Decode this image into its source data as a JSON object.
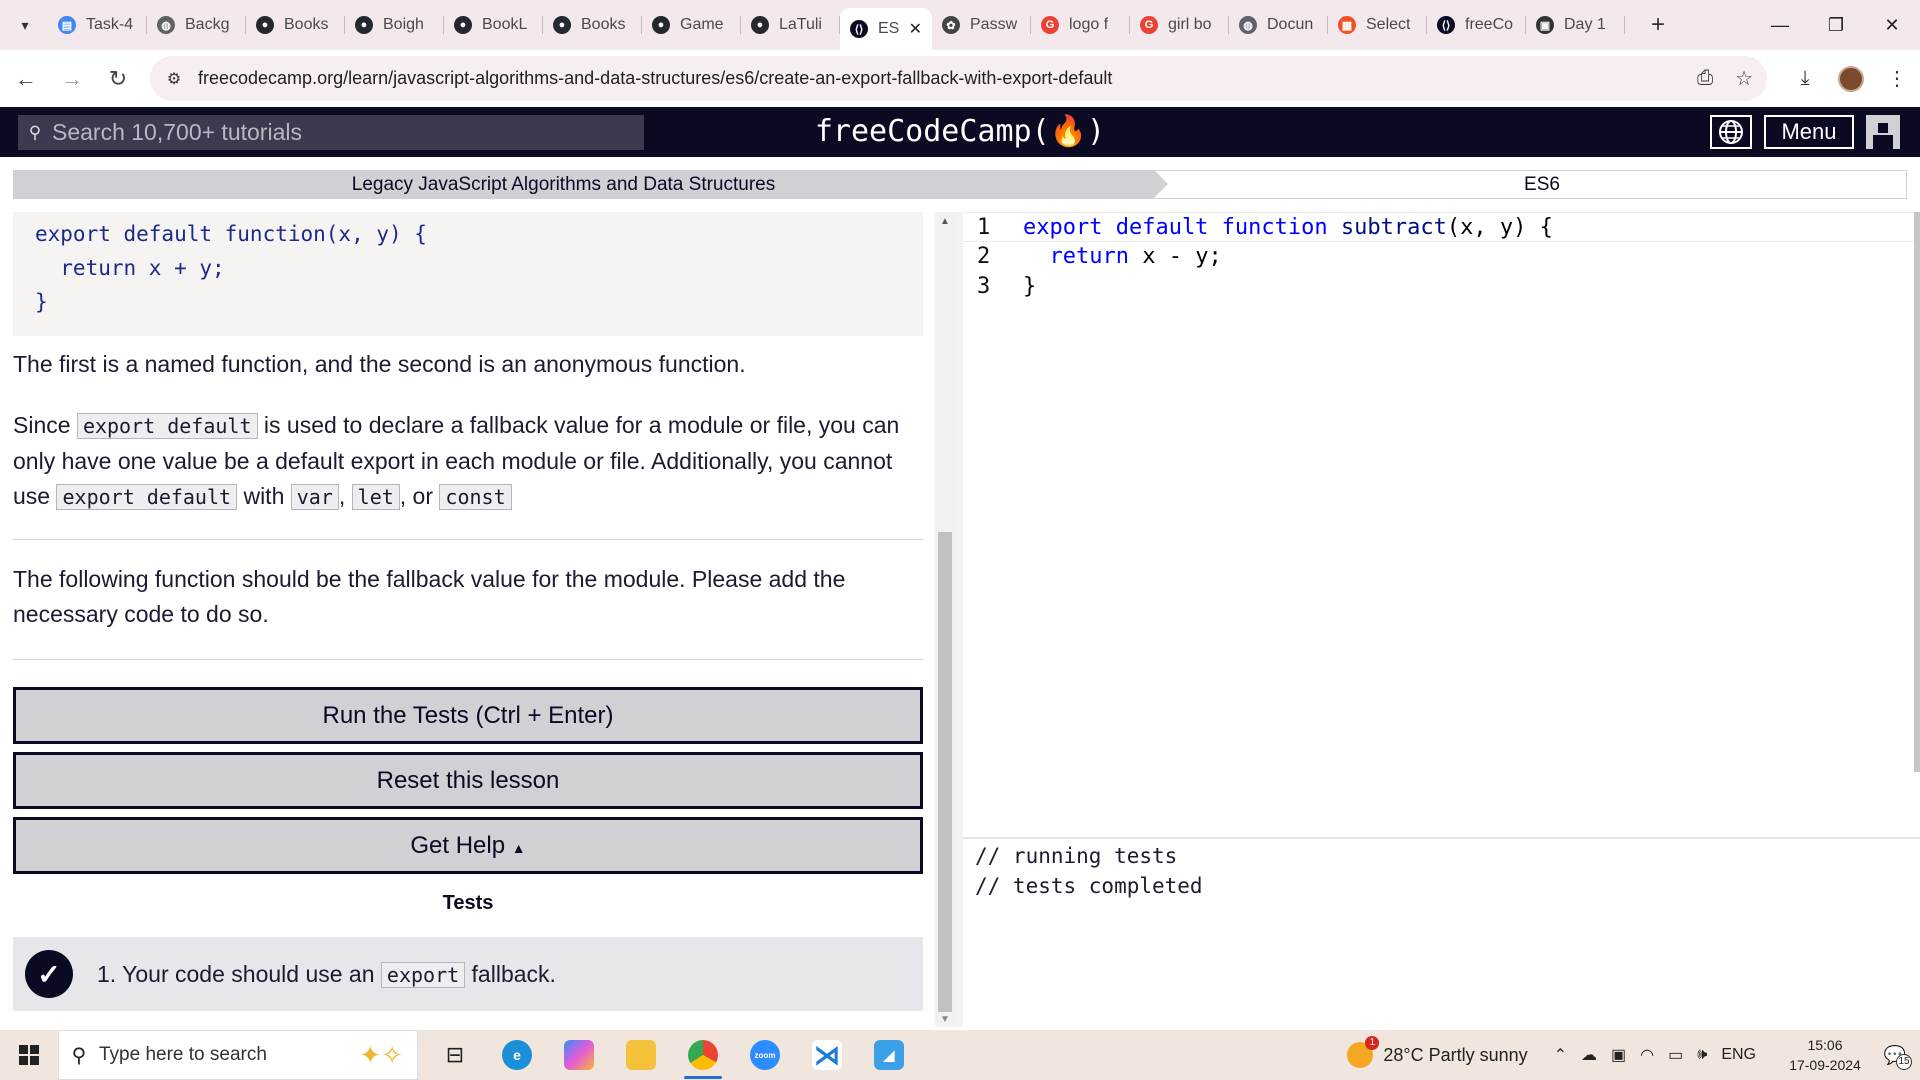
{
  "browser": {
    "tabs": [
      {
        "label": "Task-4",
        "favicon": "docs-icon",
        "color": "#4285f4"
      },
      {
        "label": "Backg",
        "favicon": "globe-icon",
        "color": "#5f6368"
      },
      {
        "label": "Books",
        "favicon": "github-icon",
        "color": "#24292e"
      },
      {
        "label": "Boigh",
        "favicon": "github-icon",
        "color": "#24292e"
      },
      {
        "label": "BookL",
        "favicon": "github-icon",
        "color": "#24292e"
      },
      {
        "label": "Books",
        "favicon": "github-icon",
        "color": "#24292e"
      },
      {
        "label": "Game",
        "favicon": "github-icon",
        "color": "#24292e"
      },
      {
        "label": "LaTuli",
        "favicon": "github-icon",
        "color": "#24292e"
      },
      {
        "label": "ES",
        "favicon": "freecodecamp-icon",
        "color": "#0a0a23",
        "active": true
      },
      {
        "label": "Passw",
        "favicon": "openai-icon",
        "color": "#444"
      },
      {
        "label": "logo f",
        "favicon": "google-icon",
        "color": "#ea4335"
      },
      {
        "label": "girl bo",
        "favicon": "google-icon",
        "color": "#ea4335"
      },
      {
        "label": "Docun",
        "favicon": "globe-icon",
        "color": "#5f6368"
      },
      {
        "label": "Select",
        "favicon": "microsoft-icon",
        "color": "#f25022"
      },
      {
        "label": "freeCo",
        "favicon": "freecodecamp-icon",
        "color": "#0a0a23"
      },
      {
        "label": "Day 1",
        "favicon": "classroom-icon",
        "color": "#333"
      }
    ],
    "url": "freecodecamp.org/learn/javascript-algorithms-and-data-structures/es6/create-an-export-fallback-with-export-default"
  },
  "fcc": {
    "search_placeholder": "Search 10,700+ tutorials",
    "logo_text": "freeCodeCamp(",
    "logo_end": ")",
    "menu_label": "Menu",
    "breadcrumb_super": "Legacy JavaScript Algorithms and Data Structures",
    "breadcrumb_block": "ES6"
  },
  "instructions": {
    "example_code": [
      "export default function(x, y) {",
      "  return x + y;",
      "}"
    ],
    "p1": "The first is a named function, and the second is an anonymous function.",
    "p2_a": "Since ",
    "p2_code": "export default",
    "p2_b": " is used to declare a fallback value for a module or file, you can only have one value be a default export in each module or file. Additionally, you cannot use ",
    "p2_code2": "export default",
    "p2_c": " with ",
    "p2_var": "var",
    "p2_sep1": ", ",
    "p2_let": "let",
    "p2_sep2": ", or ",
    "p2_const": "const",
    "p3": "The following function should be the fallback value for the module. Please add the necessary code to do so.",
    "run_tests_label": "Run the Tests (Ctrl + Enter)",
    "reset_label": "Reset this lesson",
    "help_label": "Get Help",
    "tests_heading": "Tests",
    "test1_a": "1. Your code should use an ",
    "test1_code": "export",
    "test1_b": " fallback."
  },
  "editor": {
    "lines": [
      {
        "n": "1",
        "kw1": "export default function",
        "name": " subtract",
        "rest": "(x, y) {"
      },
      {
        "n": "2",
        "kw1": "  return",
        "name": "",
        "rest": " x - y;"
      },
      {
        "n": "3",
        "kw1": "",
        "name": "",
        "rest": "}"
      }
    ]
  },
  "console": {
    "line1": "// running tests",
    "line2": "// tests completed"
  },
  "taskbar": {
    "search_placeholder": "Type here to search",
    "weather": "28°C  Partly sunny",
    "lang": "ENG",
    "time": "15:06",
    "date": "17-09-2024",
    "notif_count": "15"
  }
}
